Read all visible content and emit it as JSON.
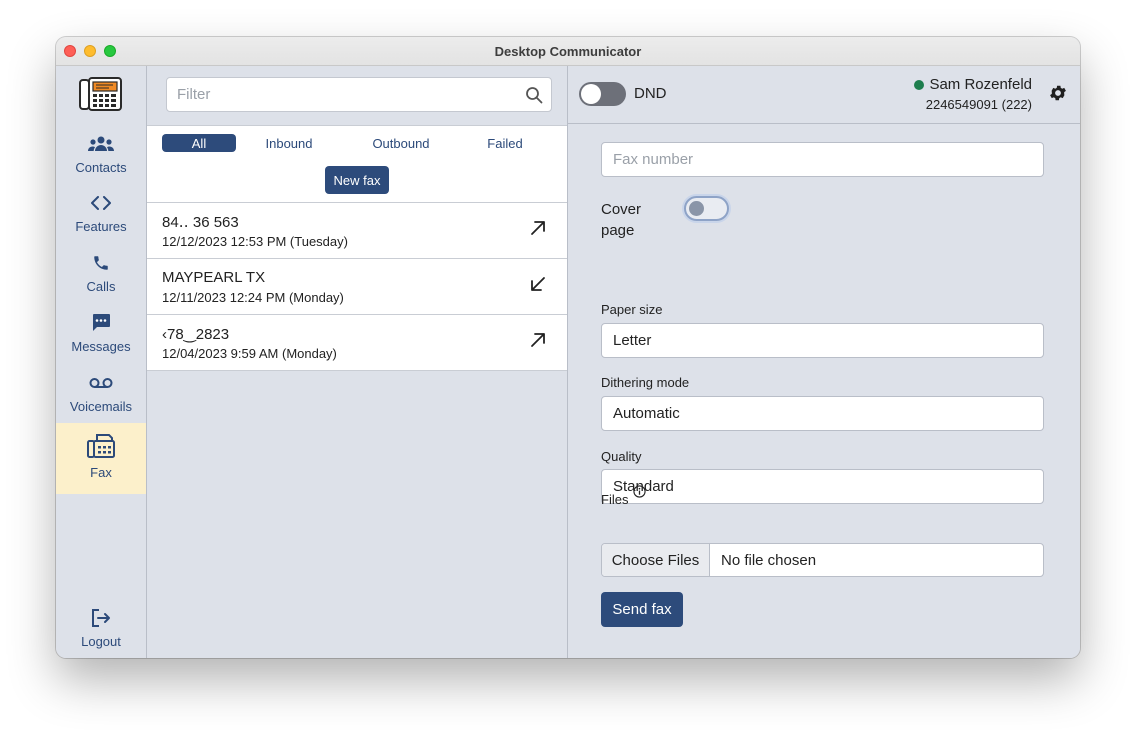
{
  "window": {
    "title": "Desktop Communicator"
  },
  "sidebar": {
    "items": [
      {
        "label": "Contacts",
        "icon": "contacts-icon"
      },
      {
        "label": "Features",
        "icon": "code-brackets-icon"
      },
      {
        "label": "Calls",
        "icon": "phone-icon"
      },
      {
        "label": "Messages",
        "icon": "chat-bubble-icon"
      },
      {
        "label": "Voicemails",
        "icon": "voicemail-icon"
      },
      {
        "label": "Fax",
        "icon": "fax-icon",
        "active": true
      }
    ],
    "logout": {
      "label": "Logout",
      "icon": "logout-icon"
    }
  },
  "middle": {
    "filter_placeholder": "Filter",
    "tabs": [
      {
        "label": "All",
        "active": true
      },
      {
        "label": "Inbound"
      },
      {
        "label": "Outbound"
      },
      {
        "label": "Failed"
      }
    ],
    "new_fax_label": "New fax",
    "faxes": [
      {
        "name": "84‥ 36  563",
        "date": "12/12/2023 12:53 PM (Tuesday)",
        "direction": "outbound"
      },
      {
        "name": "MAYPEARL TX",
        "date": "12/11/2023 12:24 PM (Monday)",
        "direction": "inbound"
      },
      {
        "name": "  ‹78‿2823",
        "date": "12/04/2023 9:59 AM (Monday)",
        "direction": "outbound"
      }
    ]
  },
  "header": {
    "dnd_label": "DND",
    "dnd_on": false,
    "user_name": "Sam Rozenfeld",
    "user_ext": "2246549091 (222)",
    "status_color": "#1e7e4e"
  },
  "form": {
    "fax_number_placeholder": "Fax number",
    "cover_page_label": "Cover page",
    "cover_page_on": false,
    "paper_size_label": "Paper size",
    "paper_size_value": "Letter",
    "dithering_label": "Dithering mode",
    "dithering_value": "Automatic",
    "quality_label": "Quality",
    "quality_value": "Standard",
    "files_label": "Files",
    "choose_files_label": "Choose Files",
    "file_status": "No file chosen",
    "send_label": "Send fax"
  },
  "colors": {
    "accent": "#2d4b7b",
    "active_nav_bg": "#fcf0cb",
    "panel_bg": "#dde1e9"
  }
}
